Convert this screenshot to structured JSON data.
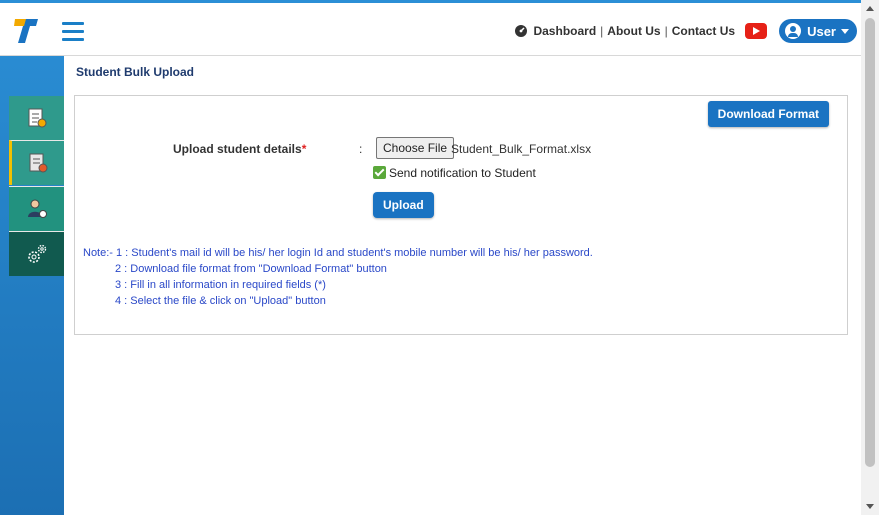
{
  "topbar": {
    "logo_icon": "tekie-logo-icon",
    "menu_icon": "hamburger-menu-icon",
    "nav": {
      "dashboard": "Dashboard",
      "about": "About Us",
      "contact": "Contact Us",
      "separator": "|"
    },
    "user_label": "User"
  },
  "sidebar": {
    "items": [
      {
        "icon": "checklist-icon"
      },
      {
        "icon": "document-settings-icon"
      },
      {
        "icon": "user-settings-icon"
      },
      {
        "icon": "gears-icon"
      }
    ]
  },
  "page": {
    "title": "Student Bulk Upload"
  },
  "form": {
    "download_label": "Download Format",
    "upload_label": "Upload student details",
    "required_mark": "*",
    "colon": ":",
    "choose_file_label": "Choose File",
    "file_name": "Student_Bulk_Format.xlsx",
    "notify_label": "Send notification to Student",
    "notify_checked": true,
    "upload_button": "Upload"
  },
  "notes": {
    "line1": "Note:- 1 : Student's mail id will be his/ her login Id and student's mobile number will be his/ her password.",
    "line2": "2 : Download file format from \"Download Format\" button",
    "line3": "3 : Fill in all information in required fields (*)",
    "line4": "4 : Select the file & click on \"Upload\" button"
  },
  "colors": {
    "accent": "#1a73c2",
    "note_text": "#2a48c8",
    "sidebar_teal": "#2f9a8c",
    "sidebar_dark": "#115a4f",
    "youtube_red": "#e62117"
  }
}
